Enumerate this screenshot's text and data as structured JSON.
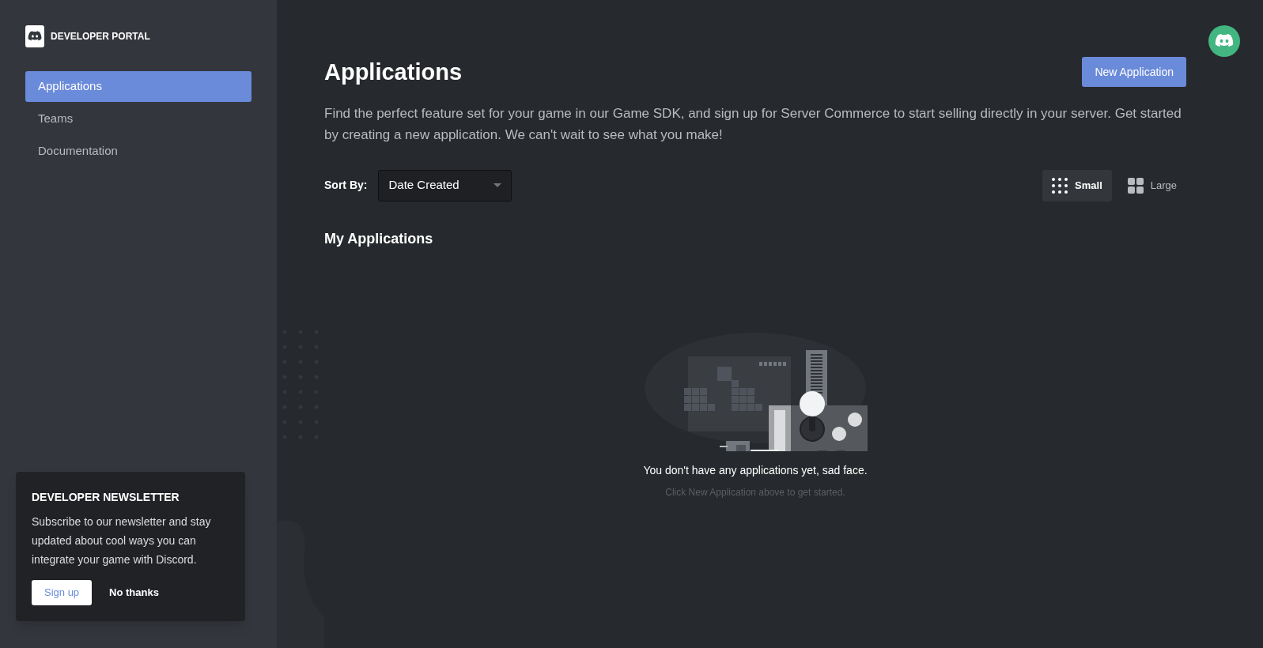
{
  "sidebar": {
    "brand": "DEVELOPER PORTAL",
    "items": [
      {
        "label": "Applications",
        "selected": true
      },
      {
        "label": "Teams",
        "selected": false
      },
      {
        "label": "Documentation",
        "selected": false
      }
    ]
  },
  "newsletter": {
    "title": "DEVELOPER NEWSLETTER",
    "text": "Subscribe to our newsletter and stay updated about cool ways you can integrate your game with Discord.",
    "buttons": [
      "Sign up",
      "No thanks"
    ]
  },
  "header": {
    "title": "Applications",
    "button": "New Application",
    "description": "Find the perfect feature set for your game in our Game SDK, and sign up for Server Commerce to start selling directly in your server. Get started by creating a new application. We can't wait to see what you make!"
  },
  "sort": {
    "label": "Sort By:",
    "value": "Date Created"
  },
  "view_options": [
    {
      "label": "Small",
      "kind": "small",
      "selected": true
    },
    {
      "label": "Large",
      "kind": "large",
      "selected": false
    }
  ],
  "section_title": "My Applications",
  "empty_state": {
    "title": "You don't have any applications yet, sad face.",
    "hint": "Click New Application above to get started."
  }
}
